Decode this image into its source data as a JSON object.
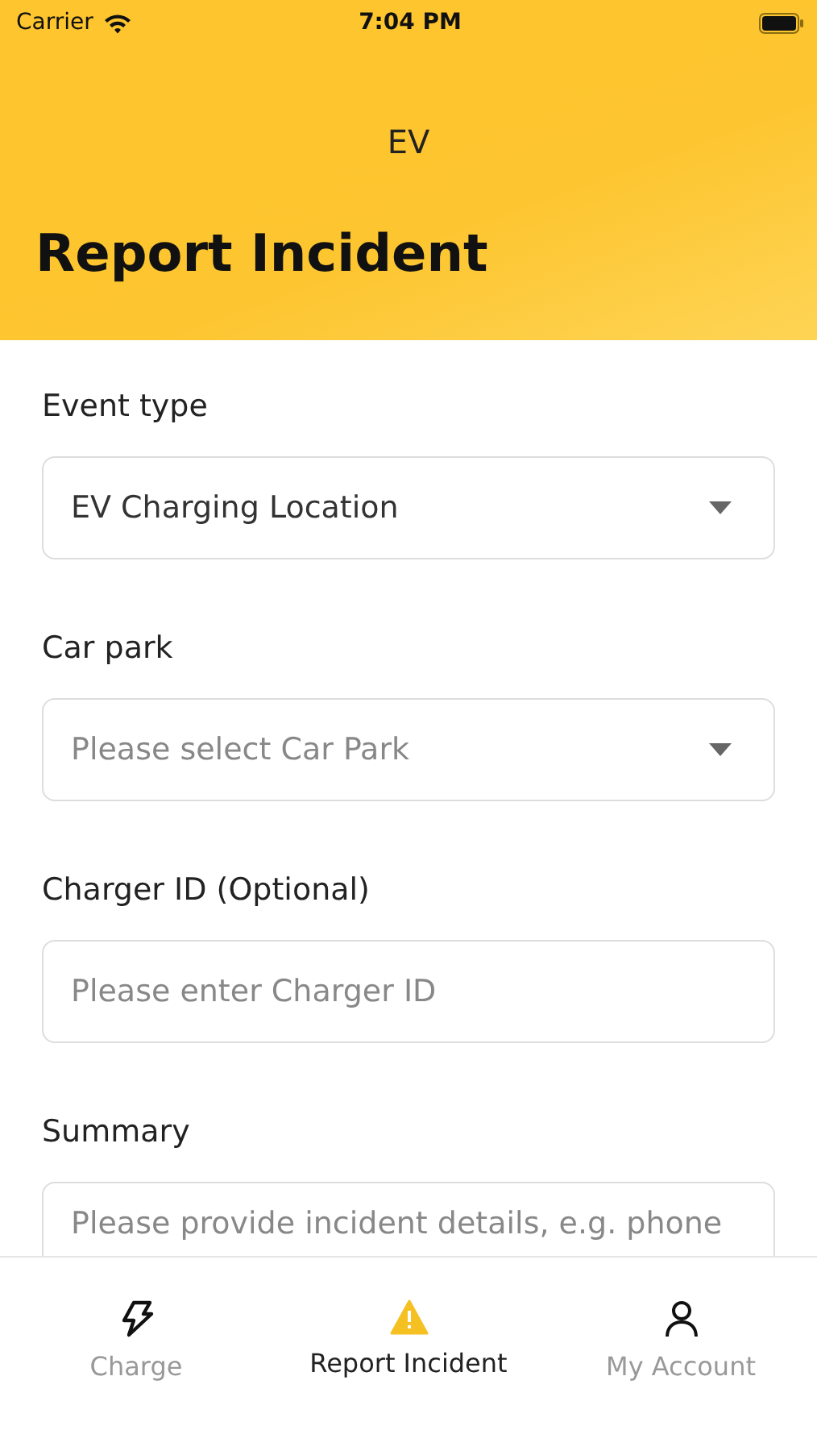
{
  "status_bar": {
    "carrier": "Carrier",
    "time": "7:04 PM"
  },
  "header": {
    "app_name": "EV",
    "title": "Report Incident"
  },
  "fields": [
    {
      "kind": "select",
      "label": "Event type",
      "value": "EV Charging Location"
    },
    {
      "kind": "select",
      "label": "Car park",
      "placeholder": "Please select Car Park"
    },
    {
      "kind": "input",
      "label": "Charger ID (Optional)",
      "placeholder": "Please enter Charger ID"
    },
    {
      "kind": "textarea",
      "label": "Summary",
      "placeholder": "Please provide incident details, e.g. phone"
    }
  ],
  "tabs": [
    {
      "kind": "bolt",
      "label": "Charge",
      "selected": false
    },
    {
      "kind": "warning",
      "label": "Report Incident",
      "selected": true
    },
    {
      "kind": "person",
      "label": "My Account",
      "selected": false
    }
  ]
}
